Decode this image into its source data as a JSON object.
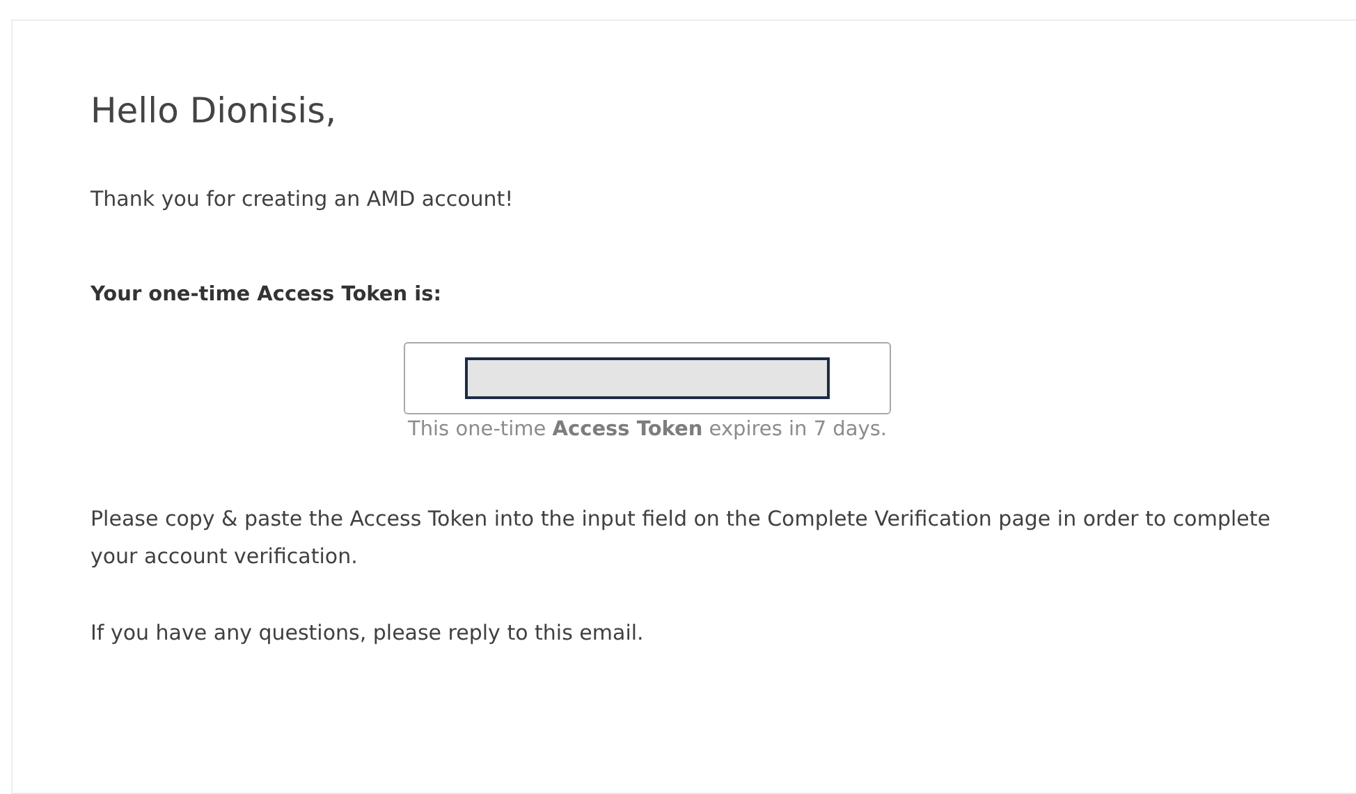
{
  "greeting": "Hello Dionisis,",
  "intro": "Thank you for creating an AMD account!",
  "token_label": "Your one-time Access Token is:",
  "token_note": "This one-time **Access Token** expires in 7 days.",
  "instructions": "Please copy & paste the Access Token into the input field on the Complete Verification page in order to complete your account verification.",
  "closing": "If you have any questions, please reply to this email."
}
